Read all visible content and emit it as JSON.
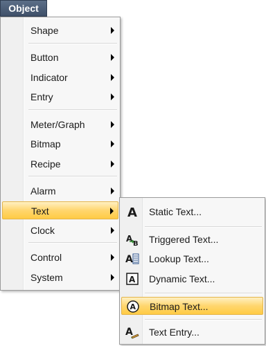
{
  "menubar": {
    "title": "Object"
  },
  "menu": {
    "items": [
      {
        "label": "Shape",
        "has_submenu": true
      },
      {
        "label": "Button",
        "has_submenu": true
      },
      {
        "label": "Indicator",
        "has_submenu": true
      },
      {
        "label": "Entry",
        "has_submenu": true
      },
      {
        "label": "Meter/Graph",
        "has_submenu": true
      },
      {
        "label": "Bitmap",
        "has_submenu": true
      },
      {
        "label": "Recipe",
        "has_submenu": true
      },
      {
        "label": "Alarm",
        "has_submenu": true
      },
      {
        "label": "Text",
        "has_submenu": true,
        "active": true
      },
      {
        "label": "Clock",
        "has_submenu": true
      },
      {
        "label": "Control",
        "has_submenu": true
      },
      {
        "label": "System",
        "has_submenu": true
      }
    ]
  },
  "submenu": {
    "items": [
      {
        "label": "Static Text...",
        "icon": "static-text-icon"
      },
      {
        "label": "Triggered Text...",
        "icon": "triggered-text-icon"
      },
      {
        "label": "Lookup Text...",
        "icon": "lookup-text-icon"
      },
      {
        "label": "Dynamic Text...",
        "icon": "dynamic-text-icon"
      },
      {
        "label": "Bitmap Text...",
        "icon": "bitmap-text-icon",
        "active": true
      },
      {
        "label": "Text Entry...",
        "icon": "text-entry-icon"
      }
    ]
  },
  "colors": {
    "menubar_bg": "#4a5b74",
    "highlight": "#ffd66e",
    "menu_bg": "#f7f7f7"
  }
}
